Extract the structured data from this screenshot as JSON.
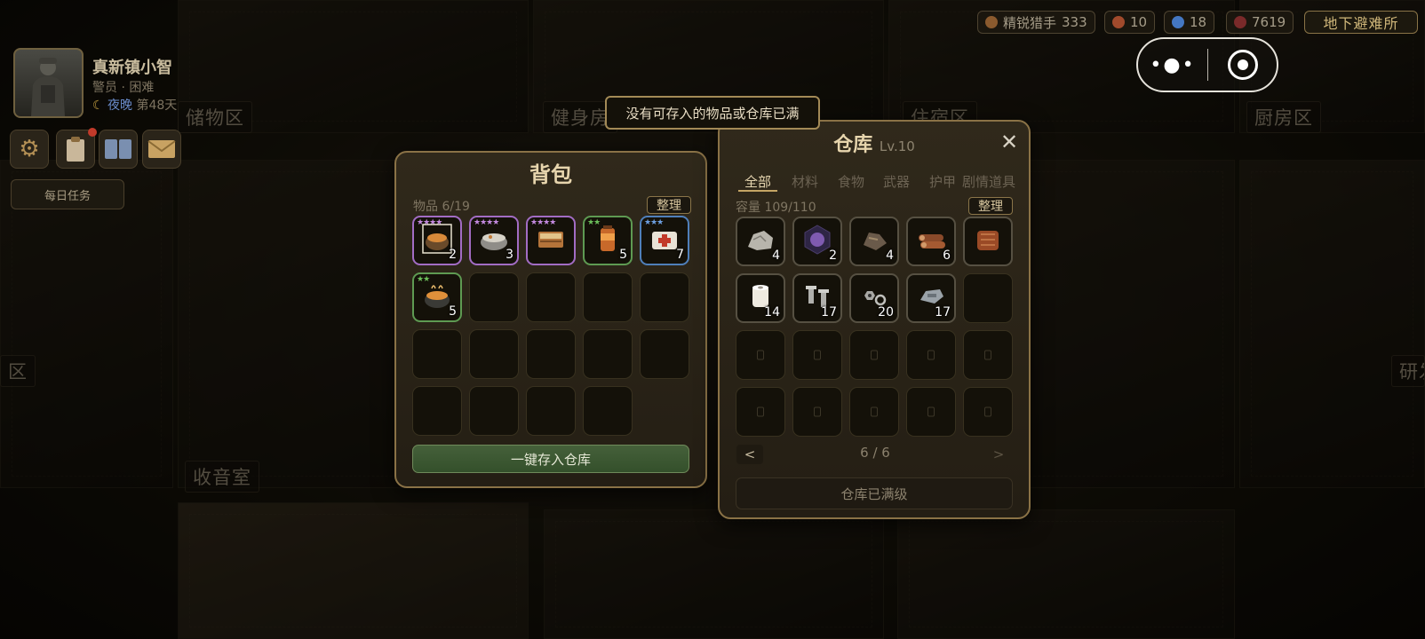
{
  "player": {
    "name": "真新镇小智",
    "role": "警员",
    "dot": "·",
    "difficulty": "困难",
    "time_of_day": "夜晚",
    "day": "第48天"
  },
  "daily_task": "每日任务",
  "resources": [
    {
      "label": "精锐猎手",
      "value": "333",
      "color": "#8a5a2e"
    },
    {
      "label": "",
      "value": "10",
      "color": "#a14a2c"
    },
    {
      "label": "",
      "value": "18",
      "color": "#4477c2"
    },
    {
      "label": "",
      "value": "7619",
      "color": "#7a2a2a"
    }
  ],
  "location_button": "地下避难所",
  "rooms": {
    "storage_area": "储物区",
    "gym": "健身房",
    "dorm": "住宿区",
    "kitchen": "厨房区",
    "left_area": "区",
    "radio_room": "收音室",
    "research": "研发"
  },
  "toast": "没有可存入的物品或仓库已满",
  "backpack": {
    "title": "背包",
    "items_label": "物品 6/19",
    "arrange": "整理",
    "store_all": "一键存入仓库",
    "slots": [
      {
        "icon": "cooking-pot-icon",
        "rarity": "purple",
        "stars": "★★★★",
        "count": "2"
      },
      {
        "icon": "stew-bowl-icon",
        "rarity": "purple",
        "stars": "★★★★",
        "count": "3"
      },
      {
        "icon": "book-icon",
        "rarity": "purple",
        "stars": "★★★★",
        "count": ""
      },
      {
        "icon": "orange-drink-icon",
        "rarity": "green",
        "stars": "★★",
        "count": "5"
      },
      {
        "icon": "medkit-icon",
        "rarity": "blue",
        "stars": "★★★",
        "count": "7"
      },
      {
        "icon": "soup-pot-icon",
        "rarity": "green",
        "stars": "★★",
        "count": "5"
      }
    ]
  },
  "warehouse": {
    "title": "仓库",
    "level": "Lv.10",
    "tabs": [
      "全部",
      "材料",
      "食物",
      "武器",
      "护甲",
      "剧情道具"
    ],
    "capacity": "容量 109/110",
    "arrange": "整理",
    "page": "6 / 6",
    "prev": "<",
    "next": ">",
    "max_button": "仓库已满级",
    "close": "✕",
    "items": [
      {
        "icon": "ore-icon",
        "count": "4"
      },
      {
        "icon": "crystal-icon",
        "count": "2"
      },
      {
        "icon": "scrap-icon",
        "count": "4"
      },
      {
        "icon": "logs-icon",
        "count": "6"
      },
      {
        "icon": "wood-plank-icon",
        "count": ""
      },
      {
        "icon": "toilet-paper-icon",
        "count": "14"
      },
      {
        "icon": "screws-icon",
        "count": "17"
      },
      {
        "icon": "nuts-bolts-icon",
        "count": "20"
      },
      {
        "icon": "metal-part-icon",
        "count": "17"
      }
    ]
  }
}
